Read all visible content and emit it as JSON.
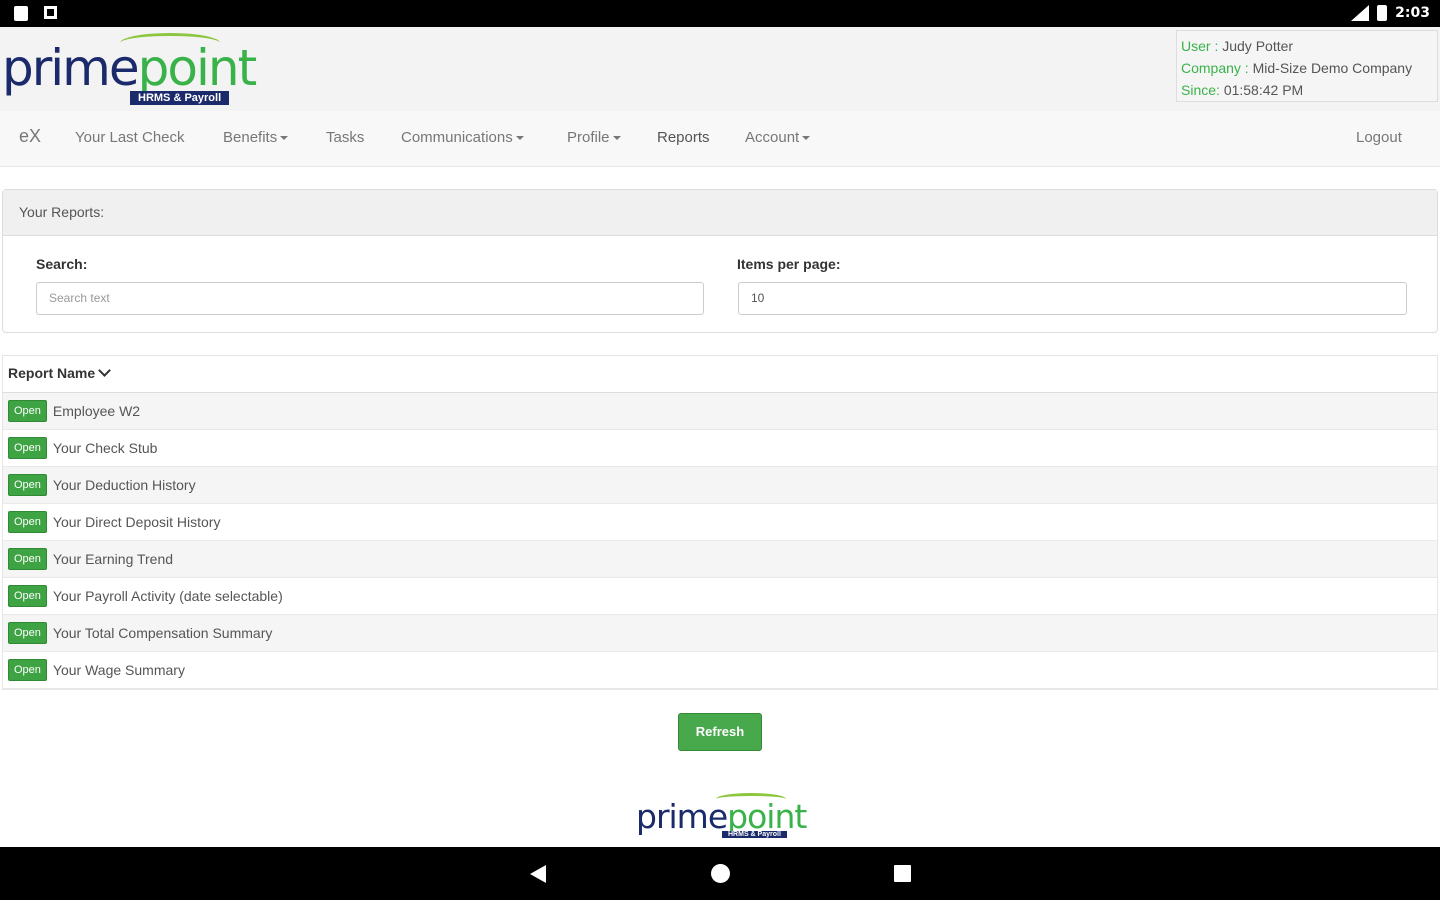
{
  "statusbar": {
    "time": "2:03",
    "icons": [
      "sd-card-icon",
      "notification-icon",
      "signal-icon",
      "battery-icon"
    ]
  },
  "brand": {
    "logo_prime": "prime",
    "logo_point": "point",
    "logo_tagline": "HRMS & Payroll"
  },
  "user": {
    "user_label": "User :",
    "user_value": "Judy Potter",
    "company_label": "Company :",
    "company_value": "Mid-Size Demo Company",
    "since_label": "Since:",
    "since_value": "01:58:42 PM"
  },
  "nav": {
    "brand": "eX",
    "items": [
      "Your Last Check",
      "Benefits",
      "Tasks",
      "Communications",
      "Profile",
      "Reports",
      "Account"
    ],
    "logout": "Logout"
  },
  "reports_panel": {
    "heading": "Your Reports:",
    "search_label": "Search:",
    "search_placeholder": "Search text",
    "items_label": "Items per page:",
    "items_value": "10"
  },
  "table": {
    "header": "Report Name",
    "open_label": "Open",
    "rows": [
      "Employee W2",
      "Your Check Stub",
      "Your Deduction History",
      "Your Direct Deposit History",
      "Your Earning Trend",
      "Your Payroll Activity (date selectable)",
      "Your Total Compensation Summary",
      "Your Wage Summary"
    ]
  },
  "refresh_label": "Refresh",
  "colors": {
    "accent_green": "#3ea343",
    "brand_navy": "#1b2a6b"
  }
}
